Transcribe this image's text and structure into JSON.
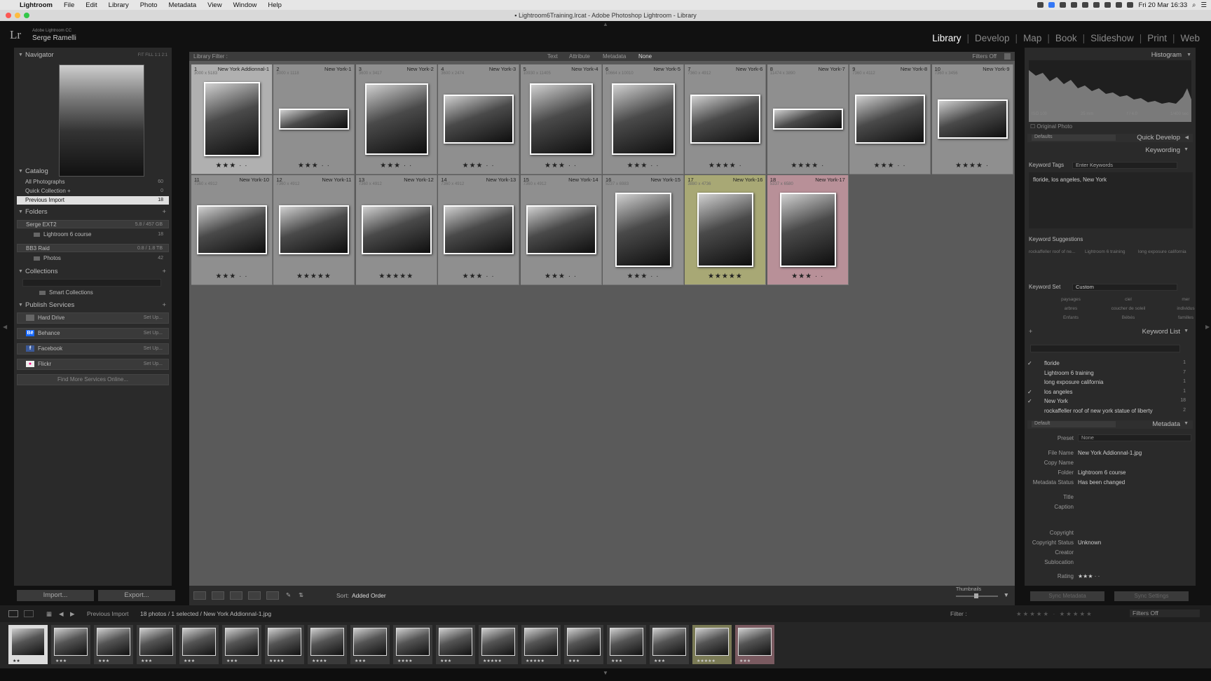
{
  "menubar": {
    "app": "Lightroom",
    "items": [
      "File",
      "Edit",
      "Library",
      "Photo",
      "Metadata",
      "View",
      "Window",
      "Help"
    ],
    "clock": "Fri 20 Mar 16:33"
  },
  "titlebar": {
    "title": "Lightroom6Training.lrcat - Adobe Photoshop Lightroom - Library"
  },
  "identity": {
    "logo": "Lr",
    "product": "Adobe Lightroom CC",
    "user": "Serge Ramelli"
  },
  "modules": [
    "Library",
    "Develop",
    "Map",
    "Book",
    "Slideshow",
    "Print",
    "Web"
  ],
  "left": {
    "navigator": {
      "title": "Navigator",
      "zoom": "FIT  FILL  1:1  2:1"
    },
    "catalog": {
      "title": "Catalog",
      "items": [
        {
          "label": "All Photographs",
          "count": "60"
        },
        {
          "label": "Quick Collection +",
          "count": "0"
        },
        {
          "label": "Previous Import",
          "count": "18"
        }
      ]
    },
    "folders": {
      "title": "Folders",
      "volumes": [
        {
          "label": "Serge EXT2",
          "info": "5.8 / 457 GB",
          "sub": "Lightroom 6 course",
          "count": "18"
        },
        {
          "label": "BB3 Raid",
          "info": "0.8 / 1.8 TB",
          "sub": "Photos",
          "count": "42"
        }
      ]
    },
    "collections": {
      "title": "Collections",
      "smart": "Smart Collections"
    },
    "publish": {
      "title": "Publish Services",
      "services": [
        {
          "label": "Hard Drive",
          "action": "Set Up..."
        },
        {
          "label": "Behance",
          "action": "Set Up..."
        },
        {
          "label": "Facebook",
          "action": "Set Up..."
        },
        {
          "label": "Flickr",
          "action": "Set Up..."
        }
      ],
      "find_more": "Find More Services Online..."
    },
    "import_label": "Import...",
    "export_label": "Export..."
  },
  "filterbar": {
    "title": "Library Filter :",
    "options": [
      "Text",
      "Attribute",
      "Metadata",
      "None"
    ],
    "filters_off": "Filters Off"
  },
  "grid": [
    {
      "idx": "1",
      "name": "New York Addionnal-1",
      "dim": "3000 x 5183",
      "ext": "JPG",
      "stars": "★★★ · ·",
      "thumb": "portrait",
      "state": "sel"
    },
    {
      "idx": "2",
      "name": "New York-1",
      "dim": "3000 x 1118",
      "ext": "",
      "stars": "★★★ · ·",
      "thumb": "pano",
      "state": ""
    },
    {
      "idx": "3",
      "name": "New York-2",
      "dim": "3600 x 3417",
      "ext": "",
      "stars": "★★★ · ·",
      "thumb": "square",
      "state": ""
    },
    {
      "idx": "4",
      "name": "New York-3",
      "dim": "3600 x 2474",
      "ext": "",
      "stars": "★★★ · ·",
      "thumb": "wide",
      "state": ""
    },
    {
      "idx": "5",
      "name": "New York-4",
      "dim": "10930 x 11405",
      "ext": "",
      "stars": "★★★ · ·",
      "thumb": "square",
      "state": ""
    },
    {
      "idx": "6",
      "name": "New York-5",
      "dim": "10664 x 10010",
      "ext": "",
      "stars": "★★★ · ·",
      "thumb": "square",
      "state": ""
    },
    {
      "idx": "7",
      "name": "New York-6",
      "dim": "7360 x 4912",
      "ext": "",
      "stars": "★★★★ ·",
      "thumb": "wide",
      "state": ""
    },
    {
      "idx": "8",
      "name": "New York-7",
      "dim": "11474 x 3890",
      "ext": "",
      "stars": "★★★★ ·",
      "thumb": "pano",
      "state": ""
    },
    {
      "idx": "9",
      "name": "New York-8",
      "dim": "7360 x 4112",
      "ext": "",
      "stars": "★★★ · ·",
      "thumb": "wide",
      "state": ""
    },
    {
      "idx": "10",
      "name": "New York-9",
      "dim": "7360 x 3456",
      "ext": "",
      "stars": "★★★★ ·",
      "thumb": "pano2",
      "state": ""
    },
    {
      "idx": "11",
      "name": "New York-10",
      "dim": "7360 x 4912",
      "ext": "",
      "stars": "★★★ · ·",
      "thumb": "wide",
      "state": ""
    },
    {
      "idx": "12",
      "name": "New York-11",
      "dim": "7360 x 4912",
      "ext": "",
      "stars": "★★★★★",
      "thumb": "wide",
      "state": ""
    },
    {
      "idx": "13",
      "name": "New York-12",
      "dim": "7360 x 4912",
      "ext": "",
      "stars": "★★★★★",
      "thumb": "wide",
      "state": ""
    },
    {
      "idx": "14",
      "name": "New York-13",
      "dim": "7360 x 4912",
      "ext": "",
      "stars": "★★★ · ·",
      "thumb": "wide",
      "state": ""
    },
    {
      "idx": "15",
      "name": "New York-14",
      "dim": "7360 x 4912",
      "ext": "",
      "stars": "★★★ · ·",
      "thumb": "wide",
      "state": ""
    },
    {
      "idx": "16",
      "name": "New York-15",
      "dim": "5237 x 6983",
      "ext": "",
      "stars": "★★★ · ·",
      "thumb": "portrait",
      "state": ""
    },
    {
      "idx": "17",
      "name": "New York-16",
      "dim": "3880 x 4736",
      "ext": "",
      "stars": "★★★★★",
      "thumb": "portrait",
      "state": "green"
    },
    {
      "idx": "18",
      "name": "New York-17",
      "dim": "5337 x 6580",
      "ext": "",
      "stars": "★★★ · ·",
      "thumb": "portrait",
      "state": "red"
    }
  ],
  "toolbar": {
    "sort_label": "Sort:",
    "sort_value": "Added Order",
    "thumbnails": "Thumbnails"
  },
  "filmstripbar": {
    "source": "Previous Import",
    "summary": "18 photos / 1 selected / New York Addionnal-1.jpg",
    "filter": "Filter :",
    "filters_off": "Filters Off"
  },
  "filmstrip_stars": [
    "★★",
    "★★★",
    "★★★",
    "★★★",
    "★★★",
    "★★★",
    "★★★★",
    "★★★★",
    "★★★",
    "★★★★",
    "★★★",
    "★★★★★",
    "★★★★★",
    "★★★",
    "★★★",
    "★★★",
    "★★★★★",
    "★★★"
  ],
  "filmstrip_states": [
    "sel",
    "",
    "",
    "",
    "",
    "",
    "",
    "",
    "",
    "",
    "",
    "",
    "",
    "",
    "",
    "",
    "green",
    "red"
  ],
  "right": {
    "histogram": {
      "title": "Histogram",
      "iso": "ISO 100",
      "focal": "25 mm",
      "aperture": "f / 4.0",
      "shutter": "1/400 sec",
      "original": "Original Photo"
    },
    "quick_develop": {
      "preset": "Defaults",
      "title": "Quick Develop"
    },
    "keywording": {
      "title": "Keywording",
      "tags_label": "Keyword Tags",
      "tags_field": "Enter Keywords",
      "tags": "floride, los angeles, New York",
      "suggestions_title": "Keyword Suggestions",
      "suggestions": [
        "rockaffeller roof of ne...",
        "Lightroom 6 training",
        "long exposure california"
      ],
      "set_label": "Keyword Set",
      "set_value": "Custom",
      "set_items": [
        "paysages",
        "ciel",
        "mer",
        "arbres",
        "coucher de soleil",
        "individus",
        "Enfants",
        "Bébés",
        "familles"
      ]
    },
    "keyword_list": {
      "title": "Keyword List",
      "items": [
        {
          "label": "floride",
          "count": "1",
          "checked": "✓"
        },
        {
          "label": "Lightroom 6 training",
          "count": "7",
          "checked": ""
        },
        {
          "label": "long exposure california",
          "count": "1",
          "checked": ""
        },
        {
          "label": "los angeles",
          "count": "1",
          "checked": "✓"
        },
        {
          "label": "New York",
          "count": "18",
          "checked": "✓"
        },
        {
          "label": "rockaffeller roof of new york statue of liberty",
          "count": "2",
          "checked": ""
        }
      ]
    },
    "metadata": {
      "preset_default": "Default",
      "title": "Metadata",
      "preset_label": "Preset",
      "preset_value": "None",
      "rows": [
        {
          "label": "File Name",
          "value": "New York Addionnal-1.jpg"
        },
        {
          "label": "Copy Name",
          "value": ""
        },
        {
          "label": "Folder",
          "value": "Lightroom 6 course"
        },
        {
          "label": "Metadata Status",
          "value": "Has been changed"
        },
        {
          "label": "Title",
          "value": ""
        },
        {
          "label": "Caption",
          "value": ""
        },
        {
          "label": "Copyright",
          "value": ""
        },
        {
          "label": "Copyright Status",
          "value": "Unknown"
        },
        {
          "label": "Creator",
          "value": ""
        },
        {
          "label": "Sublocation",
          "value": ""
        },
        {
          "label": "Rating",
          "value": "★★★ · ·"
        }
      ]
    },
    "sync_metadata": "Sync Metadata",
    "sync_settings": "Sync Settings"
  }
}
